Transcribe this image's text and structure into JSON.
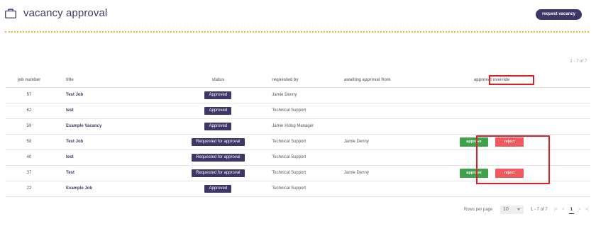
{
  "header": {
    "title": "vacancy approval",
    "icon": "briefcase-icon",
    "request_button": "request vacancy"
  },
  "range_top": "1 - 7 of 7",
  "table": {
    "columns": [
      "job number",
      "title",
      "status",
      "requested by",
      "awaiting approval from",
      "approval override"
    ],
    "rows": [
      {
        "num": "67",
        "title": "Test Job",
        "status": "Approved",
        "requested_by": "Jamie Denny",
        "awaiting": "",
        "override": false
      },
      {
        "num": "62",
        "title": "test",
        "status": "Approved",
        "requested_by": "Technical Support",
        "awaiting": "",
        "override": false
      },
      {
        "num": "59",
        "title": "Example Vacancy",
        "status": "Approved",
        "requested_by": "Jamie Hiring Manager",
        "awaiting": "",
        "override": false
      },
      {
        "num": "58",
        "title": "Test Job",
        "status": "Requested for approval",
        "requested_by": "Technical Support",
        "awaiting": "Jamie Denny",
        "override": true
      },
      {
        "num": "40",
        "title": "test",
        "status": "Requested for approval",
        "requested_by": "Technical Support",
        "awaiting": "",
        "override": false
      },
      {
        "num": "37",
        "title": "Test",
        "status": "Requested for approval",
        "requested_by": "Technical Support",
        "awaiting": "Jamie Denny",
        "override": true
      },
      {
        "num": "22",
        "title": "Example Job",
        "status": "Approved",
        "requested_by": "Technical Support",
        "awaiting": "",
        "override": false
      }
    ],
    "approve_label": "approve",
    "reject_label": "reject"
  },
  "footer": {
    "rows_per_page_label": "Rows per page",
    "rows_per_page_value": "10",
    "range": "1 - 7 of 7",
    "pager": {
      "first": "|<",
      "prev": "<",
      "current": "1",
      "next": ">",
      "last": ">|"
    }
  },
  "colors": {
    "brand": "#3d3666",
    "accent_dots": "#e8b82a",
    "approve": "#3fa34d",
    "reject": "#f05a5e",
    "highlight": "#e02020"
  }
}
